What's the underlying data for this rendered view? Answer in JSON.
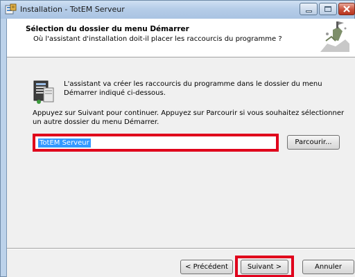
{
  "window": {
    "title": "Installation - TotEM Serveur",
    "controls": {
      "minimize": "minimize",
      "maximize": "maximize",
      "close": "close"
    }
  },
  "header": {
    "title": "Sélection du dossier du menu Démarrer",
    "subtitle": "Où l'assistant d'installation doit-il placer les raccourcis du programme ?"
  },
  "body": {
    "info_text": "L'assistant va créer les raccourcis du programme dans le dossier du menu Démarrer indiqué ci-dessous.",
    "instruction_text": "Appuyez sur Suivant pour continuer. Appuyez sur Parcourir si vous souhaitez sélectionner un autre dossier du menu Démarrer.",
    "folder_value": "TotEM Serveur",
    "browse_label": "Parcourir..."
  },
  "footer": {
    "back_label": "< Précédent",
    "next_label": "Suivant >",
    "cancel_label": "Annuler"
  },
  "colors": {
    "highlight": "#e0001b",
    "selection": "#3399ff",
    "titlebar": "#b6cde8"
  }
}
